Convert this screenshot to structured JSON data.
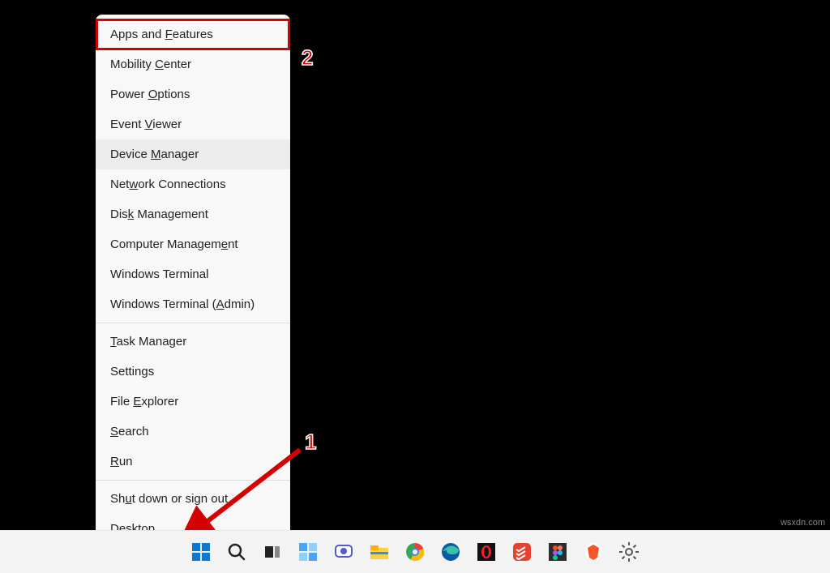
{
  "menu": {
    "items": [
      {
        "label": "Apps and Features",
        "mnemonic_index": 9,
        "highlighted": true,
        "hovered": false
      },
      {
        "label": "Mobility Center",
        "mnemonic_index": 9,
        "highlighted": false,
        "hovered": false
      },
      {
        "label": "Power Options",
        "mnemonic_index": 6,
        "highlighted": false,
        "hovered": false
      },
      {
        "label": "Event Viewer",
        "mnemonic_index": 6,
        "highlighted": false,
        "hovered": false
      },
      {
        "label": "Device Manager",
        "mnemonic_index": 7,
        "highlighted": false,
        "hovered": true
      },
      {
        "label": "Network Connections",
        "mnemonic_index": 3,
        "highlighted": false,
        "hovered": false
      },
      {
        "label": "Disk Management",
        "mnemonic_index": 3,
        "highlighted": false,
        "hovered": false
      },
      {
        "label": "Computer Management",
        "mnemonic_index": 16,
        "highlighted": false,
        "hovered": false
      },
      {
        "label": "Windows Terminal",
        "mnemonic_index": 16,
        "highlighted": false,
        "hovered": false
      },
      {
        "label": "Windows Terminal (Admin)",
        "mnemonic_index": 18,
        "highlighted": false,
        "hovered": false
      },
      {
        "sep": true
      },
      {
        "label": "Task Manager",
        "mnemonic_index": 0,
        "highlighted": false,
        "hovered": false
      },
      {
        "label": "Settings",
        "mnemonic_index": 6,
        "highlighted": false,
        "hovered": false
      },
      {
        "label": "File Explorer",
        "mnemonic_index": 5,
        "highlighted": false,
        "hovered": false
      },
      {
        "label": "Search",
        "mnemonic_index": 0,
        "highlighted": false,
        "hovered": false
      },
      {
        "label": "Run",
        "mnemonic_index": 0,
        "highlighted": false,
        "hovered": false
      },
      {
        "sep": true
      },
      {
        "label": "Shut down or sign out",
        "mnemonic_index": 2,
        "highlighted": false,
        "hovered": false
      },
      {
        "label": "Desktop",
        "mnemonic_index": 0,
        "highlighted": false,
        "hovered": false
      }
    ]
  },
  "annotations": {
    "badge1": "1",
    "badge2": "2"
  },
  "taskbar": {
    "icons": [
      {
        "name": "start-icon"
      },
      {
        "name": "search-icon"
      },
      {
        "name": "taskview-icon"
      },
      {
        "name": "widgets-icon"
      },
      {
        "name": "chat-icon"
      },
      {
        "name": "file-explorer-icon"
      },
      {
        "name": "chrome-icon"
      },
      {
        "name": "edge-icon"
      },
      {
        "name": "opera-icon"
      },
      {
        "name": "todoist-icon"
      },
      {
        "name": "figma-icon"
      },
      {
        "name": "brave-icon"
      },
      {
        "name": "settings-icon"
      }
    ]
  },
  "watermark": "wsxdn.com"
}
